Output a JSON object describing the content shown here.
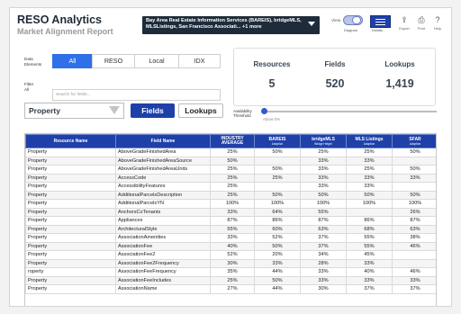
{
  "header": {
    "title": "RESO Analytics",
    "subtitle": "Market Alignment Report",
    "mls_selector": "Bay Area Real Estate Information Services (BAREIS), bridgeMLS, MLSListings, San Francisco Associati... +1 more",
    "view_label": "View",
    "toggle_label": "Diagram",
    "details_label": "Details",
    "export_label": "Export",
    "print_label": "Print",
    "help_label": "Help"
  },
  "filters": {
    "data_elements_label": "Data\nElements",
    "segments": [
      "All",
      "RESO",
      "Local",
      "IDX"
    ],
    "active_segment": "All",
    "filter_label": "Filter\nAll",
    "search_placeholder": "Search for fields...",
    "resource_type": "Property",
    "fields_button": "Fields",
    "lookups_button": "Lookups",
    "threshold_label": "Availability\nThreshold",
    "threshold_caption": "Above 0%",
    "threshold_value": 0.0
  },
  "stats": {
    "resources_label": "Resources",
    "resources_value": "5",
    "fields_label": "Fields",
    "fields_value": "520",
    "lookups_label": "Lookups",
    "lookups_value": "1,419"
  },
  "table": {
    "columns": [
      {
        "label": "Resource Name",
        "sub": ""
      },
      {
        "label": "Field Name",
        "sub": ""
      },
      {
        "label": "INDUSTRY AVERAGE",
        "sub": ""
      },
      {
        "label": "BAREIS",
        "sub": "Adoption"
      },
      {
        "label": "bridgeMLS",
        "sub": "Bridge Height"
      },
      {
        "label": "MLS Listings",
        "sub": "Adoption"
      },
      {
        "label": "SFAR",
        "sub": "Adoption"
      }
    ],
    "rows": [
      [
        "Property",
        "AboveGradeFinishedArea",
        "25%",
        "50%",
        "25%",
        "25%",
        "50%"
      ],
      [
        "Property",
        "AboveGradeFinishedAreaSource",
        "50%",
        "",
        "33%",
        "33%",
        ""
      ],
      [
        "Property",
        "AboveGradeFinishedAreaUnits",
        "25%",
        "50%",
        "33%",
        "25%",
        "50%"
      ],
      [
        "Property",
        "AccessCode",
        "25%",
        "25%",
        "33%",
        "33%",
        "33%"
      ],
      [
        "Property",
        "AccessibilityFeatures",
        "25%",
        "",
        "33%",
        "33%",
        ""
      ],
      [
        "Property",
        "AdditionalParcelsDescription",
        "25%",
        "50%",
        "50%",
        "50%",
        "50%"
      ],
      [
        "Property",
        "AdditionalParcelsYN",
        "100%",
        "100%",
        "100%",
        "100%",
        "100%"
      ],
      [
        "Property",
        "AnchorsCoTenants",
        "33%",
        "64%",
        "55%",
        "",
        "26%"
      ],
      [
        "Property",
        "Appliances",
        "87%",
        "86%",
        "87%",
        "86%",
        "87%"
      ],
      [
        "Property",
        "ArchitecturalStyle",
        "55%",
        "60%",
        "63%",
        "68%",
        "63%"
      ],
      [
        "Property",
        "AssociationAmenities",
        "33%",
        "52%",
        "37%",
        "55%",
        "38%"
      ],
      [
        "Property",
        "AssociationFee",
        "40%",
        "50%",
        "37%",
        "55%",
        "46%"
      ],
      [
        "Property",
        "AssociationFee2",
        "52%",
        "20%",
        "34%",
        "45%",
        ""
      ],
      [
        "Property",
        "AssociationFee2Frequency",
        "30%",
        "33%",
        "28%",
        "33%",
        ""
      ],
      [
        "roperty",
        "AssociationFeeFrequency",
        "35%",
        "44%",
        "33%",
        "40%",
        "46%"
      ],
      [
        "Property",
        "AssociationFeeIncludes",
        "25%",
        "50%",
        "33%",
        "33%",
        "33%"
      ],
      [
        "Property",
        "AssociationName",
        "27%",
        "44%",
        "30%",
        "37%",
        "37%"
      ]
    ]
  }
}
